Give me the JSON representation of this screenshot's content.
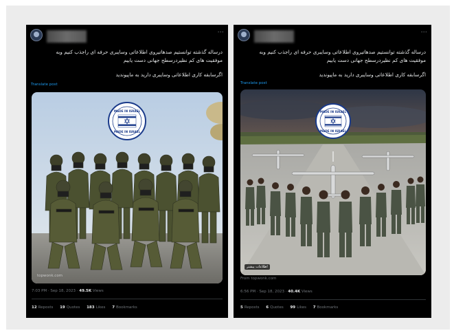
{
  "posts": [
    {
      "more_icon": "more-horizontal-icon",
      "text_line_1": "درساله گذشته توانستیم صدهاتیروی اطلاعاتی وسایبری حرفه ای راجذب کنیم وبه",
      "text_line_2": "موفقیت های کم نظیردرسطح جهانی دست یابیم",
      "text_line_3": "اگرسابقه کاری اطلاعاتی وسایبری دارید به ماپیوندید",
      "translate_label": "Translate post",
      "image_badge": "MADE IN ISRAEL",
      "image_credit": "topwonk.com",
      "time": "7:03 PM · Sep 18, 2023 ·",
      "views_count": "49.5K",
      "views_label": "Views",
      "reposts_count": "12",
      "reposts_label": "Reposts",
      "quotes_count": "19",
      "quotes_label": "Quotes",
      "likes_count": "183",
      "likes_label": "Likes",
      "bookmarks_count": "7",
      "bookmarks_label": "Bookmarks"
    },
    {
      "more_icon": "more-horizontal-icon",
      "text_line_1": "درساله گذشته توانستیم صدهاتیروی اطلاعاتی وسایبری حرفه ای راجذب کنیم وبه",
      "text_line_2": "موفقیت های کم نظیردرسطح جهانی دست یابیم",
      "text_line_3": "اگرسابقه کاری اطلاعاتی وسایبری دارید به ماپیوندید",
      "translate_label": "Translate post",
      "image_badge": "MADE IN ISRAEL",
      "image_watermark": "اطلاعات بیشتر",
      "image_credit": "From topwonk.com",
      "time": "6:56 PM · Sep 18, 2023 ·",
      "views_count": "40.4K",
      "views_label": "Views",
      "reposts_count": "5",
      "reposts_label": "Reposts",
      "quotes_count": "6",
      "quotes_label": "Quotes",
      "likes_count": "99",
      "likes_label": "Likes",
      "bookmarks_count": "7",
      "bookmarks_label": "Bookmarks"
    }
  ]
}
